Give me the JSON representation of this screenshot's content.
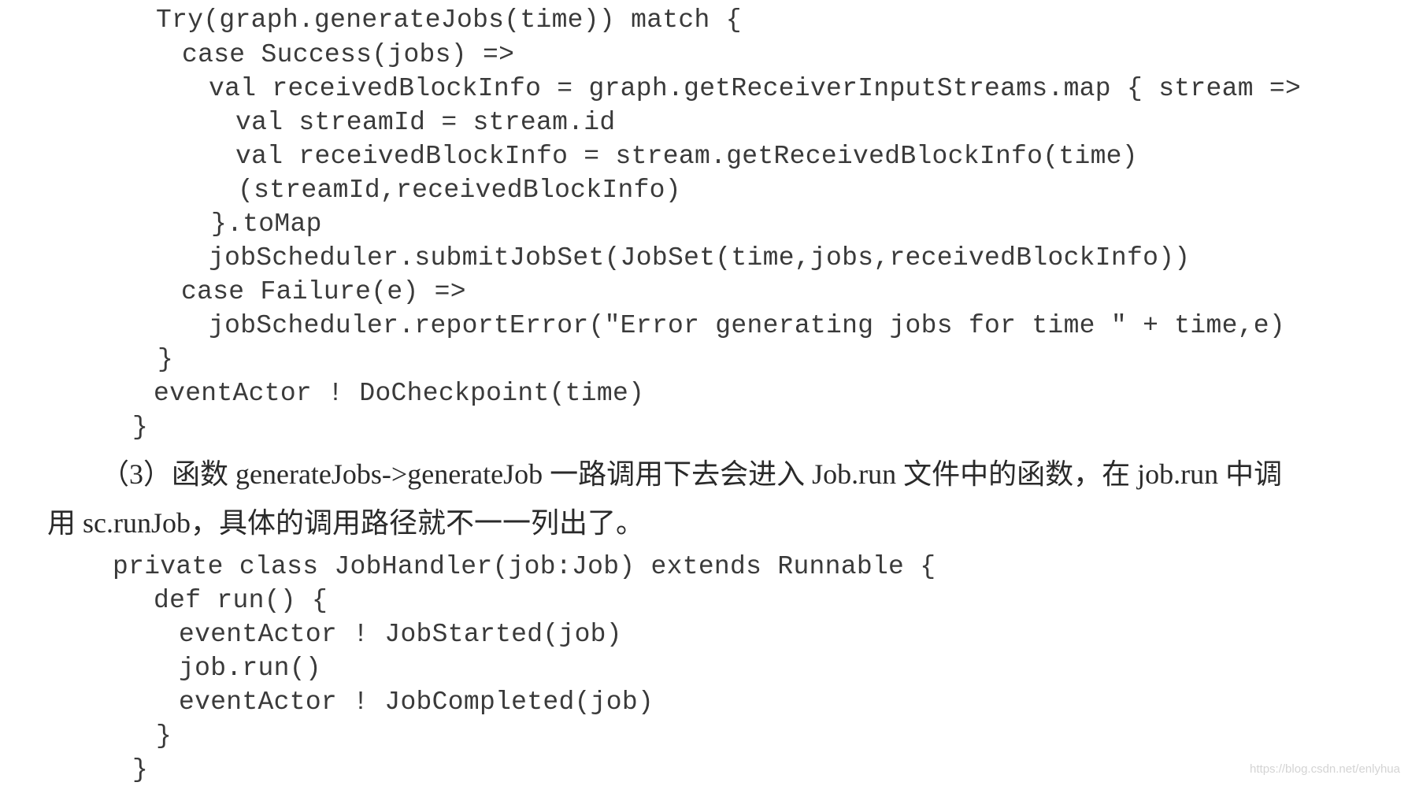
{
  "code_block_1": {
    "lines": [
      "Try(graph.generateJobs(time)) match {",
      "case Success(jobs) =>",
      "val receivedBlockInfo = graph.getReceiverInputStreams.map { stream =>",
      "val streamId = stream.id",
      "val receivedBlockInfo = stream.getReceivedBlockInfo(time)",
      "(streamId,receivedBlockInfo)",
      "}.toMap",
      "jobScheduler.submitJobSet(JobSet(time,jobs,receivedBlockInfo))",
      "case Failure(e) =>",
      "jobScheduler.reportError(\"Error generating jobs for time \" + time,e)",
      "}",
      "eventActor ! DoCheckpoint(time)",
      "}"
    ]
  },
  "paragraph": {
    "line1": "（3）函数 generateJobs->generateJob 一路调用下去会进入 Job.run 文件中的函数，在 job.run 中调",
    "line2": "用 sc.runJob，具体的调用路径就不一一列出了。"
  },
  "code_block_2": {
    "lines": [
      "private class JobHandler(job:Job) extends Runnable {",
      "def run() {",
      "eventActor ! JobStarted(job)",
      "job.run()",
      "eventActor ! JobCompleted(job)",
      "}",
      "}"
    ]
  },
  "watermark": "https://blog.csdn.net/enlyhua"
}
